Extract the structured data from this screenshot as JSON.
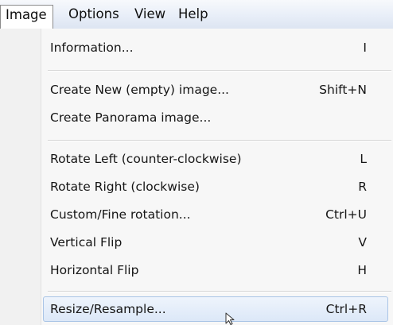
{
  "menubar": {
    "items": [
      {
        "label": "Image",
        "active": true
      },
      {
        "label": "Options",
        "active": false
      },
      {
        "label": "View",
        "active": false
      },
      {
        "label": "Help",
        "active": false
      }
    ]
  },
  "menu": {
    "items": [
      {
        "label": "Information...",
        "shortcut": "I"
      },
      {
        "label": "Create New (empty) image...",
        "shortcut": "Shift+N"
      },
      {
        "label": "Create Panorama image...",
        "shortcut": ""
      },
      {
        "label": "Rotate Left (counter-clockwise)",
        "shortcut": "L"
      },
      {
        "label": "Rotate Right (clockwise)",
        "shortcut": "R"
      },
      {
        "label": "Custom/Fine rotation...",
        "shortcut": "Ctrl+U"
      },
      {
        "label": "Vertical Flip",
        "shortcut": "V"
      },
      {
        "label": "Horizontal Flip",
        "shortcut": "H"
      },
      {
        "label": "Resize/Resample...",
        "shortcut": "Ctrl+R",
        "highlighted": true
      }
    ]
  },
  "colors": {
    "highlight_border": "#a9c4e6",
    "highlight_fill": "#dce8f8",
    "menubar_bg": "#e8eef8"
  },
  "icons": {
    "cursor": "mouse-pointer-icon"
  }
}
